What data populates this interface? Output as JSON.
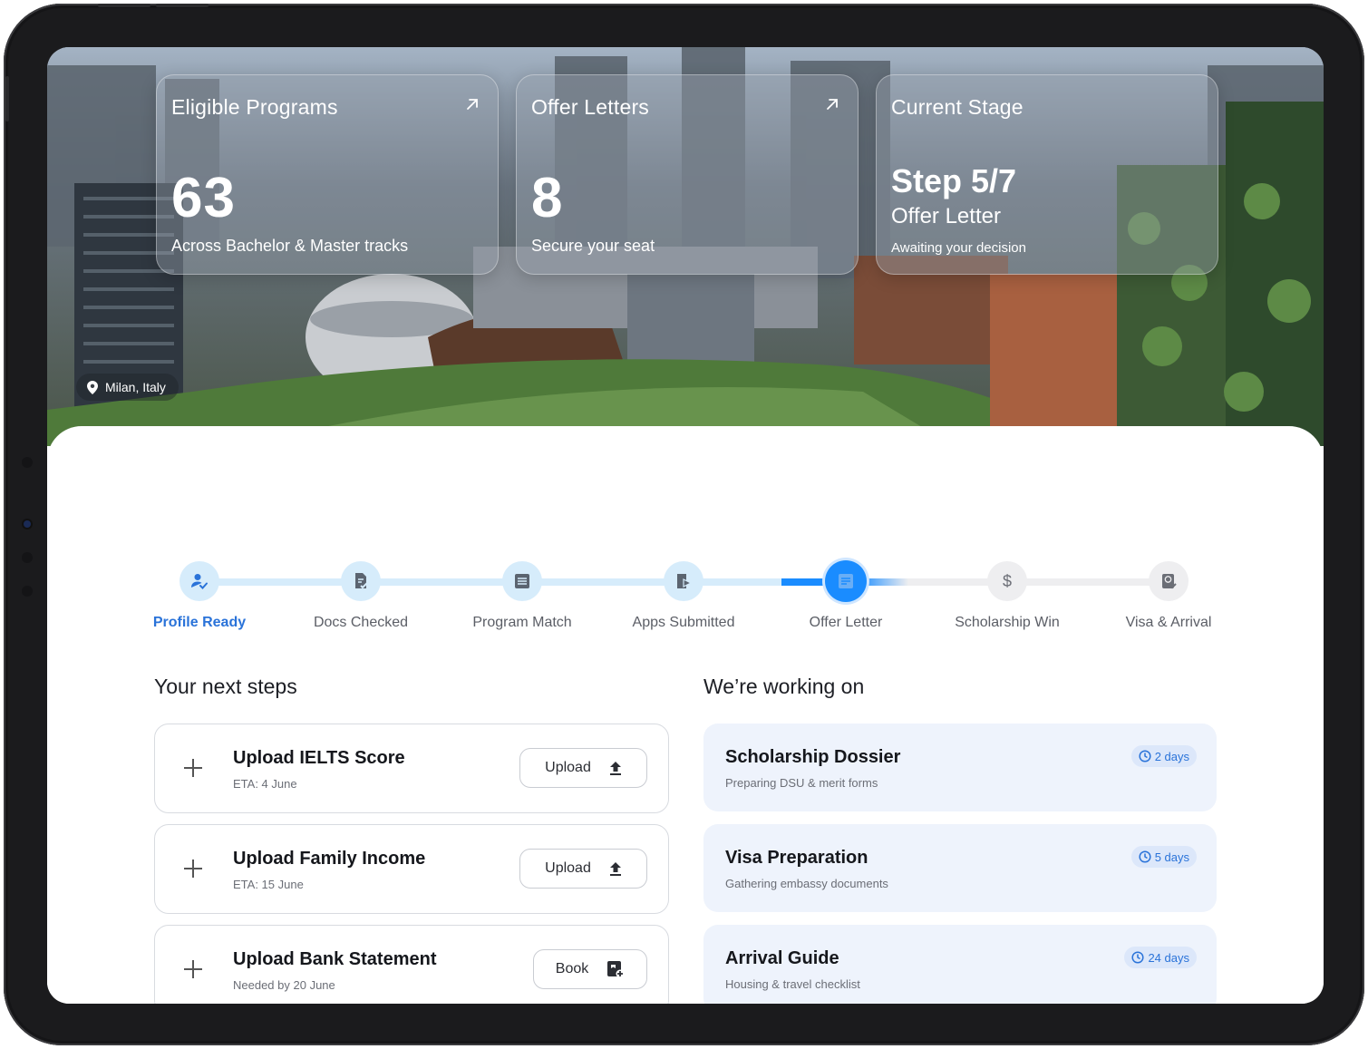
{
  "hero": {
    "location": "Milan, Italy",
    "cards": [
      {
        "title": "Eligible Programs",
        "value": "63",
        "subtitle": "Across Bachelor & Master tracks"
      },
      {
        "title": "Offer Letters",
        "value": "8",
        "subtitle": "Secure your seat"
      },
      {
        "title": "Current Stage",
        "value": "Step 5/7",
        "stage": "Offer Letter",
        "subtitle": "Awaiting your decision"
      }
    ]
  },
  "stepper": {
    "steps": [
      {
        "label": "Profile Ready",
        "state": "done",
        "icon": "user-check-icon"
      },
      {
        "label": "Docs Checked",
        "state": "done",
        "icon": "document-check-icon"
      },
      {
        "label": "Program Match",
        "state": "done",
        "icon": "list-document-icon"
      },
      {
        "label": "Apps Submitted",
        "state": "done",
        "icon": "document-send-icon"
      },
      {
        "label": "Offer Letter",
        "state": "current",
        "icon": "offer-letter-icon"
      },
      {
        "label": "Scholarship Win",
        "state": "pending",
        "icon": "dollar-icon"
      },
      {
        "label": "Visa & Arrival",
        "state": "pending",
        "icon": "passport-icon"
      }
    ]
  },
  "next_steps": {
    "title": "Your next steps",
    "items": [
      {
        "title": "Upload IELTS Score",
        "meta": "ETA: 4 June",
        "action": "Upload"
      },
      {
        "title": "Upload Family Income",
        "meta": "ETA: 15 June",
        "action": "Upload"
      },
      {
        "title": "Upload Bank Statement",
        "meta": "Needed by 20 June",
        "action": "Book"
      }
    ]
  },
  "working_on": {
    "title": "We’re working on",
    "items": [
      {
        "title": "Scholarship Dossier",
        "desc": "Preparing DSU & merit forms",
        "eta": "2 days"
      },
      {
        "title": "Visa Preparation",
        "desc": "Gathering embassy documents",
        "eta": "5 days"
      },
      {
        "title": "Arrival Guide",
        "desc": "Housing & travel checklist",
        "eta": "24 days"
      }
    ]
  },
  "colors": {
    "accent": "#1a8cff",
    "accent_light": "#d6ecfb",
    "label_active": "#2a73d9",
    "pending": "#eeeef0"
  }
}
